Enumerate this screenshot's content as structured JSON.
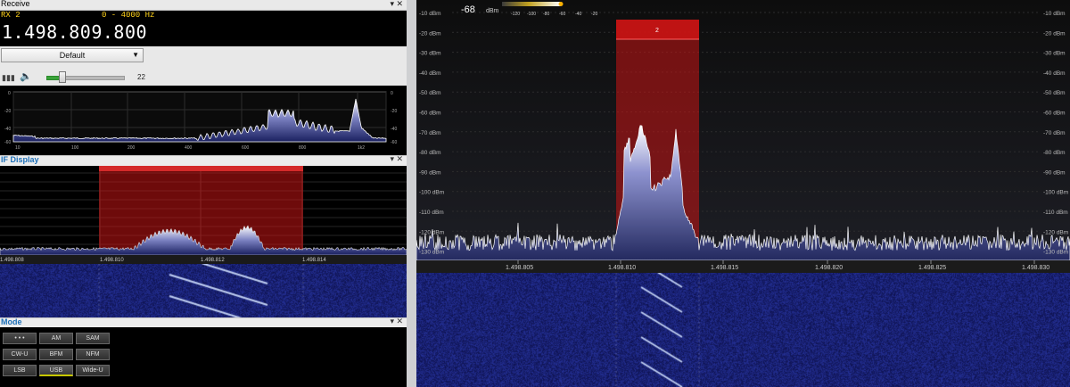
{
  "receive": {
    "title": "Receive",
    "controls": "▾ ✕",
    "rx": "RX 2",
    "range": "0 - 4000 Hz",
    "frequency": "1.498.809.800"
  },
  "audio": {
    "preset": "Default",
    "volume": "22",
    "volume_level": 0.16
  },
  "audio_spectrum": {
    "y_left": [
      "0",
      "-20",
      "-40",
      "-60"
    ],
    "y_right": [
      "0",
      "-20",
      "-40",
      "-60"
    ],
    "x_labels": [
      "10",
      "100",
      "200",
      "400",
      "600",
      "800",
      "1k6",
      "1k2"
    ]
  },
  "if_display": {
    "title": "IF Display",
    "controls": "▾ ✕",
    "x_labels": [
      "1.498.808",
      "1.498.810",
      "1.498.812",
      "1.498.814"
    ]
  },
  "mode": {
    "title": "Mode",
    "controls": "▾ ✕",
    "buttons": [
      [
        "• • •",
        "AM",
        "SAM"
      ],
      [
        "CW-U",
        "BFM",
        "NFM"
      ],
      [
        "LSB",
        "USB",
        "Wide-U"
      ]
    ],
    "selected": "USB"
  },
  "spectrum": {
    "level": "-68",
    "unit": "dBm",
    "scale_labels": [
      "-120",
      "-100",
      "-80",
      "-60",
      "-40",
      "-20"
    ],
    "dbm_labels": [
      "-10 dBm",
      "-20 dBm",
      "-30 dBm",
      "-40 dBm",
      "-50 dBm",
      "-60 dBm",
      "-70 dBm",
      "-80 dBm",
      "-90 dBm",
      "-100 dBm",
      "-110 dBm",
      "-120 dBm",
      "-130 dBm"
    ],
    "freq_labels": [
      "1.498.805",
      "1.498.810",
      "1.498.815",
      "1.498.820",
      "1.498.825",
      "1.498.830"
    ],
    "channel_label": "2"
  },
  "colors": {
    "accent": "#1c6fb8",
    "freq_text": "#ffd21a",
    "channel": "#c81414",
    "spectrum_fill": "#4a4f8c",
    "waterfall": "#12196a"
  }
}
